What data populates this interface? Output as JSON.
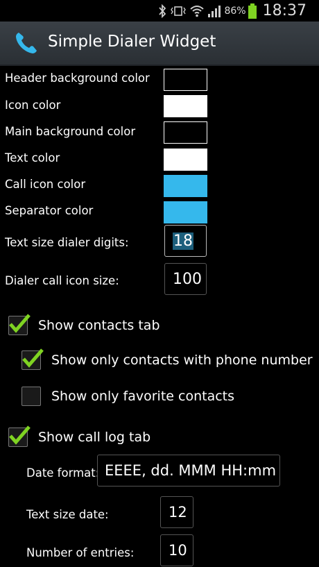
{
  "status_bar": {
    "battery_percent": "86%",
    "time": "18:37",
    "icons": [
      "bluetooth-icon",
      "vibrate-icon",
      "wifi-icon",
      "signal-icon",
      "battery-icon"
    ]
  },
  "action_bar": {
    "title": "Simple Dialer Widget",
    "icon": "phone-icon"
  },
  "colors": {
    "header_background": "#000000",
    "icon": "#ffffff",
    "main_background": "#000000",
    "text": "#ffffff",
    "call_icon": "#35b8ec",
    "separator": "#35b8ec",
    "check": "#7fd322"
  },
  "settings": {
    "header_bg_label": "Header background color",
    "icon_color_label": "Icon color",
    "main_bg_label": "Main background color",
    "text_color_label": "Text color",
    "call_icon_color_label": "Call icon color",
    "separator_color_label": "Separator color",
    "text_size_digits_label": "Text size dialer digits:",
    "text_size_digits_value": "18",
    "call_icon_size_label": "Dialer call icon size:",
    "call_icon_size_value": "100",
    "show_contacts_tab": {
      "label": "Show contacts tab",
      "checked": true
    },
    "only_with_phone": {
      "label": "Show only contacts with phone number",
      "checked": true
    },
    "only_favorites": {
      "label": "Show only favorite contacts",
      "checked": false
    },
    "show_call_log_tab": {
      "label": "Show call log tab",
      "checked": true
    },
    "date_format_label": "Date format:",
    "date_format_value": "EEEE, dd. MMM HH:mm",
    "text_size_date_label": "Text size date:",
    "text_size_date_value": "12",
    "num_entries_label": "Number of entries:",
    "num_entries_value": "10"
  }
}
